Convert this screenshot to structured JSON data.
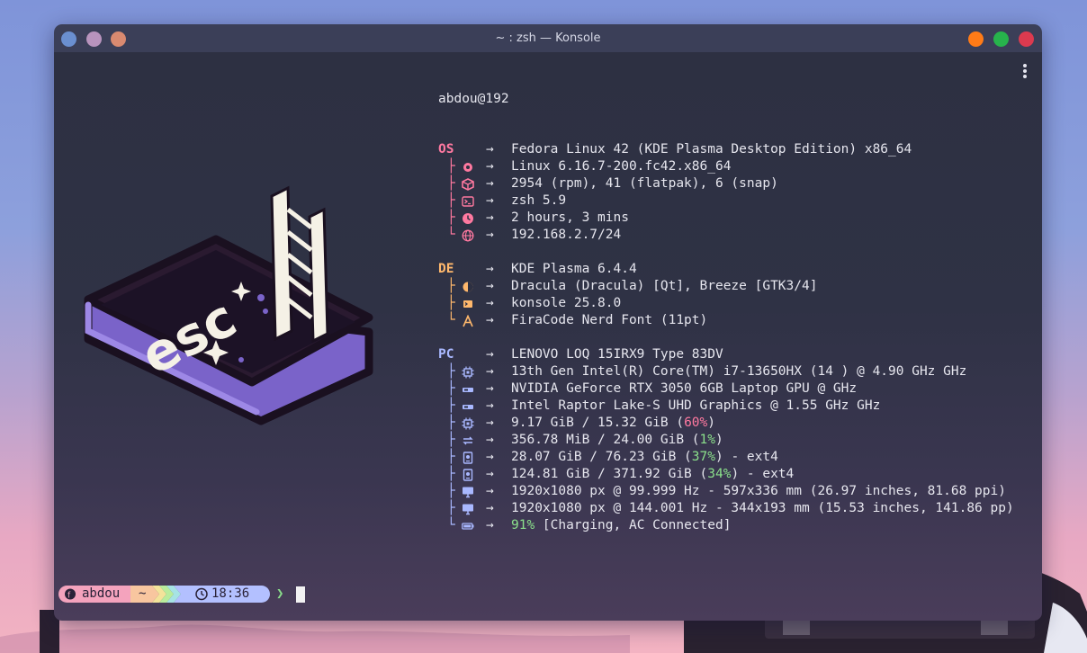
{
  "window": {
    "title": "~ : zsh — Konsole"
  },
  "colors": {
    "os": "#ff79a0",
    "de": "#ffb86c",
    "pc": "#a9b8ff",
    "green": "#8be08b"
  },
  "logo_text": "esc",
  "fetch": {
    "user": "abdou@192",
    "sections": [
      {
        "key": "OS",
        "rows": [
          {
            "icon": "",
            "value": "Fedora Linux 42 (KDE Plasma Desktop Edition) x86_64"
          },
          {
            "icon": "gear-icon",
            "value": "Linux 6.16.7-200.fc42.x86_64"
          },
          {
            "icon": "package-icon",
            "value": "2954 (rpm), 41 (flatpak), 6 (snap)"
          },
          {
            "icon": "terminal-icon",
            "value": "zsh 5.9"
          },
          {
            "icon": "clock-icon",
            "value": "2 hours, 3 mins"
          },
          {
            "icon": "globe-icon",
            "value": "192.168.2.7/24"
          }
        ]
      },
      {
        "key": "DE",
        "rows": [
          {
            "icon": "",
            "value": "KDE Plasma 6.4.4"
          },
          {
            "icon": "theme-icon",
            "value": "Dracula (Dracula) [Qt], Breeze [GTK3/4]"
          },
          {
            "icon": "terminal-small-icon",
            "value": "konsole 25.8.0"
          },
          {
            "icon": "font-icon",
            "value": "FiraCode Nerd Font (11pt)"
          }
        ]
      },
      {
        "key": "PC",
        "rows": [
          {
            "icon": "",
            "value": "LENOVO LOQ 15IRX9 Type 83DV"
          },
          {
            "icon": "cpu-icon",
            "value": "13th Gen Intel(R) Core(TM) i7-13650HX (14      ) @ 4.90 GHz GHz"
          },
          {
            "icon": "gpu-icon",
            "value": "NVIDIA GeForce RTX 3050 6GB Laptop GPU @  GHz"
          },
          {
            "icon": "gpu-icon",
            "value": "Intel Raptor Lake-S UHD Graphics @ 1.55 GHz GHz"
          },
          {
            "icon": "memory-icon",
            "pre": "9.17 GiB / 15.32 GiB (",
            "pct": "60%",
            "post": ")",
            "pct_color": "red"
          },
          {
            "icon": "swap-icon",
            "pre": "356.78 MiB / 24.00 GiB (",
            "pct": "1%",
            "post": ")",
            "pct_color": "green"
          },
          {
            "icon": "disk-icon",
            "pre": "28.07 GiB / 76.23 GiB (",
            "pct": "37%",
            "post": ") - ext4",
            "pct_color": "green"
          },
          {
            "icon": "disk-icon",
            "pre": "124.81 GiB / 371.92 GiB (",
            "pct": "34%",
            "post": ") - ext4",
            "pct_color": "green"
          },
          {
            "icon": "monitor-icon",
            "value": "1920x1080 px @ 99.999 Hz - 597x336 mm (26.97 inches, 81.68 ppi)"
          },
          {
            "icon": "monitor-icon",
            "value": "1920x1080 px @ 144.001 Hz - 344x193 mm (15.53 inches, 141.86 pp)"
          },
          {
            "icon": "battery-icon",
            "pre": "",
            "pct": "91%",
            "post": " [Charging, AC Connected]",
            "pct_color": "green"
          }
        ]
      }
    ]
  },
  "prompt": {
    "user": "abdou",
    "dir": "~",
    "time": "18:36",
    "symbol": "❯"
  }
}
